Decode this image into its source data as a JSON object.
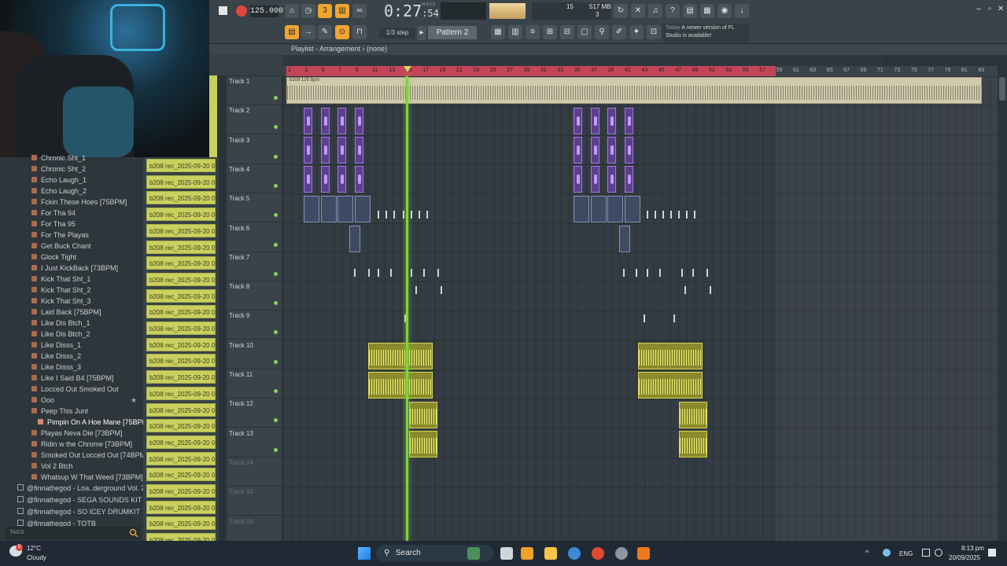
{
  "toolbar": {
    "tempo": "125.000",
    "time_main": "0:27",
    "time_sub": ":54",
    "time_format": "M:S:CS",
    "cpu": "15",
    "memory": "517 MB",
    "polyphony": "3",
    "step": "1/3 step",
    "pattern": "Pattern 2",
    "news_day": "Today",
    "news_text": "A newer version of FL Studio is available!"
  },
  "playlist": {
    "title": "Playlist - Arrangement",
    "pattern_ref": "(none)",
    "clip_label": "b208 125 bpm",
    "ruler": [
      "1",
      "3",
      "5",
      "7",
      "9",
      "11",
      "13",
      "15",
      "17",
      "19",
      "21",
      "23",
      "25",
      "27",
      "29",
      "31",
      "33",
      "35",
      "37",
      "39",
      "41",
      "43",
      "45",
      "47",
      "49",
      "51",
      "53",
      "55",
      "57",
      "59",
      "61",
      "63",
      "65",
      "67",
      "69",
      "71",
      "73",
      "75",
      "77",
      "79",
      "81",
      "83"
    ],
    "tracks": [
      "Track 1",
      "Track 2",
      "Track 3",
      "Track 4",
      "Track 5",
      "Track 6",
      "Track 7",
      "Track 8",
      "Track 9",
      "Track 10",
      "Track 11",
      "Track 12",
      "Track 13",
      "Track 14",
      "Track 15",
      "Track 16"
    ]
  },
  "browser": {
    "items": [
      "Chronic Sht_1",
      "Chronic Sht_2",
      "Echo Laugh_1",
      "Echo Laugh_2",
      "Fckin These Hoes [75BPM]",
      "For Tha 94",
      "For Tha 95",
      "For The Playas",
      "Get Buck Chant",
      "Glock Tight",
      "I Just KickBack [73BPM]",
      "Kick That Sht_1",
      "Kick That Sht_2",
      "Kick That Sht_3",
      "Laid Back [75BPM]",
      "Like Dis Btch_1",
      "Like Dis Btch_2",
      "Like Disss_1",
      "Like Disss_2",
      "Like Disss_3",
      "Like I Said B4 [75BPM]",
      "Locced Out Smoked Out",
      "Ooo",
      "Peep This Junt",
      "Pimpin On A Hoe Mane [75BPM]",
      "Playas Neva Die [73BPM]",
      "Ridin w the Chrome [73BPM]",
      "Smoked Out Locced Out [74BPM]",
      "Vol 2 Btch",
      "Whatsup W That Weed [73BPM]"
    ],
    "packs": [
      "@finnathegod - Loa..derground Vol. 2",
      "@finnathegod - SEGA SOUNDS KIT",
      "@finnathegod - SO ICEY DRUMKIT",
      "@finnathegod - TOTB"
    ],
    "tags_label": "TAGS"
  },
  "clips": {
    "label": "b208 rec_2025-09-20 00..."
  },
  "taskbar": {
    "weather_temp": "12°C",
    "weather_desc": "Cloudy",
    "weather_badge": "5",
    "search": "Search",
    "language": "ENG",
    "time": "8:13 pm",
    "date": "20/09/2025"
  },
  "colors": {
    "ruler_accent": "#c4455a",
    "playhead": "#7fd33b",
    "clip_green": "#c9d05e",
    "toolbar_orange": "#f0a531"
  }
}
